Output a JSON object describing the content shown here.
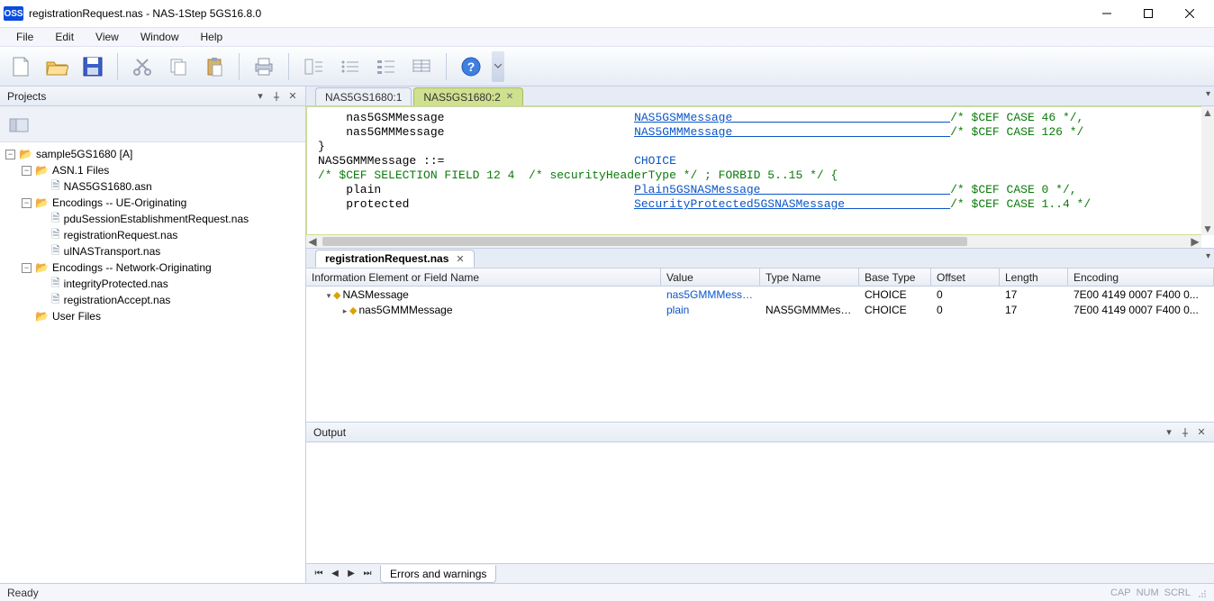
{
  "window": {
    "title": "registrationRequest.nas - NAS-1Step 5GS16.8.0",
    "app_badge": "OSS"
  },
  "menu": [
    "File",
    "Edit",
    "View",
    "Window",
    "Help"
  ],
  "projects": {
    "title": "Projects",
    "tree": [
      {
        "depth": 0,
        "exp": "-",
        "icon": "folder",
        "label": "sample5GS1680 [A]"
      },
      {
        "depth": 1,
        "exp": "-",
        "icon": "folder",
        "label": "ASN.1 Files"
      },
      {
        "depth": 2,
        "exp": " ",
        "icon": "file",
        "label": "NAS5GS1680.asn"
      },
      {
        "depth": 1,
        "exp": "-",
        "icon": "folder",
        "label": "Encodings -- UE-Originating"
      },
      {
        "depth": 2,
        "exp": " ",
        "icon": "file",
        "label": "pduSessionEstablishmentRequest.nas"
      },
      {
        "depth": 2,
        "exp": " ",
        "icon": "file",
        "label": "registrationRequest.nas"
      },
      {
        "depth": 2,
        "exp": " ",
        "icon": "file",
        "label": "ulNASTransport.nas"
      },
      {
        "depth": 1,
        "exp": "-",
        "icon": "folder",
        "label": "Encodings -- Network-Originating"
      },
      {
        "depth": 2,
        "exp": " ",
        "icon": "file",
        "label": "integrityProtected.nas"
      },
      {
        "depth": 2,
        "exp": " ",
        "icon": "file",
        "label": "registrationAccept.nas"
      },
      {
        "depth": 1,
        "exp": " ",
        "icon": "folder",
        "label": "User Files"
      }
    ]
  },
  "code_tabs": {
    "inactive": "NAS5GS1680:1",
    "active": "NAS5GS1680:2"
  },
  "code": {
    "l1a": "    nas5GSMMessage",
    "l1b": "NAS5GSMMessage",
    "l1c": "/* $CEF CASE 46 */,",
    "l2a": "    nas5GMMMessage",
    "l2b": "NAS5GMMMessage",
    "l2c": "/* $CEF CASE 126 */",
    "l3": "}",
    "l4": "",
    "l5a": "NAS5GMMMessage ::=",
    "l5b": "CHOICE",
    "l6": "/* $CEF SELECTION FIELD 12 4  /* securityHeaderType */ ; FORBID 5..15 */ {",
    "l7a": "    plain",
    "l7b": "Plain5GSNASMessage",
    "l7c": "/* $CEF CASE 0 */,",
    "l8a": "    protected",
    "l8b": "SecurityProtected5GSNASMessage",
    "l8c": "/* $CEF CASE 1..4 */"
  },
  "table": {
    "tab": "registrationRequest.nas",
    "columns": [
      "Information Element or Field Name",
      "Value",
      "Type Name",
      "Base Type",
      "Offset",
      "Length",
      "Encoding"
    ],
    "rows": [
      {
        "indent": 0,
        "tri": "▾",
        "name": "NASMessage",
        "value": "nas5GMMMessa...",
        "type": "",
        "base": "CHOICE",
        "offset": "0",
        "length": "17",
        "enc": "7E00 4149 0007 F400 0..."
      },
      {
        "indent": 1,
        "tri": "▸",
        "name": "nas5GMMMessage",
        "value": "plain",
        "type": "NAS5GMMMess...",
        "base": "CHOICE",
        "offset": "0",
        "length": "17",
        "enc": "7E00 4149 0007 F400 0..."
      }
    ]
  },
  "output": {
    "title": "Output",
    "footer_tab": "Errors and warnings"
  },
  "status": {
    "ready": "Ready",
    "cap": "CAP",
    "num": "NUM",
    "scrl": "SCRL"
  }
}
